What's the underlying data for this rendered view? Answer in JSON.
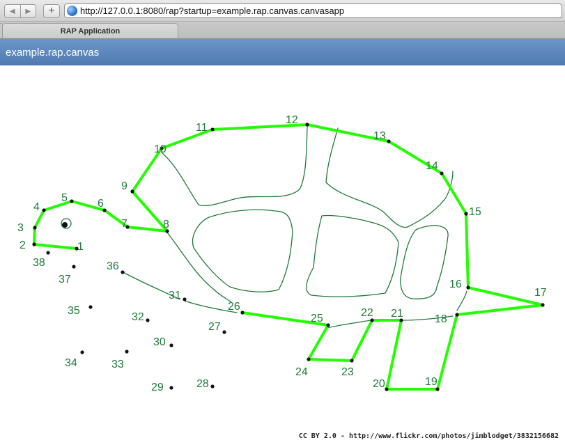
{
  "browser": {
    "url": "http://127.0.0.1:8080/rap?startup=example.rap.canvas.canvasapp",
    "tab_title": "RAP Application",
    "back_icon": "◀",
    "forward_icon": "▶",
    "add_icon": "+"
  },
  "app": {
    "title": "example.rap.canvas"
  },
  "credit": "CC BY 2.0 - http://www.flickr.com/photos/jimblodget/3832156682",
  "colors": {
    "line": "#22ff00",
    "ink": "#1f7a3a",
    "dot": "#111111"
  },
  "drawing": {
    "dots": [
      {
        "n": "1"
      },
      {
        "n": "2"
      },
      {
        "n": "3"
      },
      {
        "n": "4"
      },
      {
        "n": "5"
      },
      {
        "n": "6"
      },
      {
        "n": "7"
      },
      {
        "n": "8"
      },
      {
        "n": "9"
      },
      {
        "n": "10"
      },
      {
        "n": "11"
      },
      {
        "n": "12"
      },
      {
        "n": "13"
      },
      {
        "n": "14"
      },
      {
        "n": "15"
      },
      {
        "n": "16"
      },
      {
        "n": "17"
      },
      {
        "n": "18"
      },
      {
        "n": "19"
      },
      {
        "n": "20"
      },
      {
        "n": "21"
      },
      {
        "n": "22"
      },
      {
        "n": "23"
      },
      {
        "n": "24"
      },
      {
        "n": "25"
      },
      {
        "n": "26"
      },
      {
        "n": "27"
      },
      {
        "n": "28"
      },
      {
        "n": "29"
      },
      {
        "n": "30"
      },
      {
        "n": "31"
      },
      {
        "n": "32"
      },
      {
        "n": "33"
      },
      {
        "n": "34"
      },
      {
        "n": "35"
      },
      {
        "n": "36"
      },
      {
        "n": "37"
      },
      {
        "n": "38"
      }
    ]
  }
}
